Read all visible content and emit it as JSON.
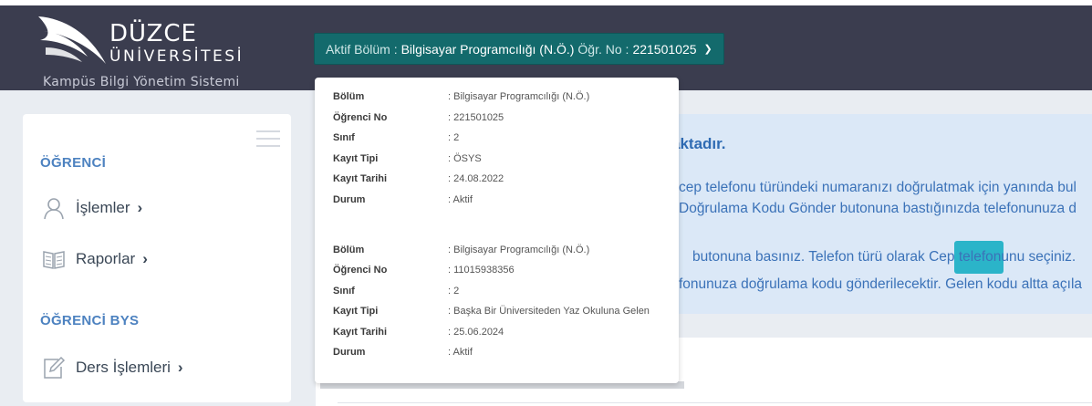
{
  "header": {
    "logo_name": "DÜZCE",
    "logo_sub": "ÜNİVERSİTESİ",
    "logo_tag": "Kampüs Bilgi Yönetim Sistemi",
    "active_prefix": "Aktif Bölüm :",
    "active_program": "Bilgisayar Programcılığı (N.Ö.)",
    "student_prefix": "Öğr. No :",
    "student_no": "221501025",
    "chevron_icon": "chevron-down-icon"
  },
  "sidebar": {
    "section1": "ÖĞRENCİ",
    "items1": [
      {
        "label": "İşlemler",
        "icon": "user-icon"
      },
      {
        "label": "Raporlar",
        "icon": "book-icon"
      }
    ],
    "section2": "ÖĞRENCİ BYS",
    "items2": [
      {
        "label": "Ders İşlemleri",
        "icon": "edit-icon"
      }
    ]
  },
  "alert": {
    "title": "aktadır.",
    "line1": "cep telefonu türündeki numaranızı doğrulatmak için yanında bul",
    "line2": "Doğrulama Kodu Gönder butonuna bastığınızda telefonunuza d",
    "line3": "butonuna basınız. Telefon türü olarak Cep telefonunu seçiniz.",
    "line4": "fonunuza doğrulama kodu gönderilecektir. Gelen kodu altta açıla"
  },
  "dropdown": {
    "records": [
      {
        "rows": [
          {
            "key": "Bölüm",
            "value": ": Bilgisayar Programcılığı (N.Ö.)"
          },
          {
            "key": "Öğrenci No",
            "value": ": 221501025"
          },
          {
            "key": "Sınıf",
            "value": ": 2"
          },
          {
            "key": "Kayıt Tipi",
            "value": ": ÖSYS"
          },
          {
            "key": "Kayıt Tarihi",
            "value": ": 24.08.2022"
          },
          {
            "key": "Durum",
            "value": ": Aktif"
          }
        ]
      },
      {
        "rows": [
          {
            "key": "Bölüm",
            "value": ": Bilgisayar Programcılığı (N.Ö.)"
          },
          {
            "key": "Öğrenci No",
            "value": ": 11015938356"
          },
          {
            "key": "Sınıf",
            "value": ": 2"
          },
          {
            "key": "Kayıt Tipi",
            "value": ": Başka Bir Üniversiteden Yaz Okuluna Gelen"
          },
          {
            "key": "Kayıt Tarihi",
            "value": ": 25.06.2024"
          },
          {
            "key": "Durum",
            "value": ": Aktif"
          }
        ]
      }
    ]
  },
  "colors": {
    "header_bg": "#3b3d4f",
    "button_bg": "#136a6c",
    "accent_blue": "#4d82c0",
    "alert_bg": "#dbe8f7",
    "alert_button": "#2bb4c9"
  }
}
